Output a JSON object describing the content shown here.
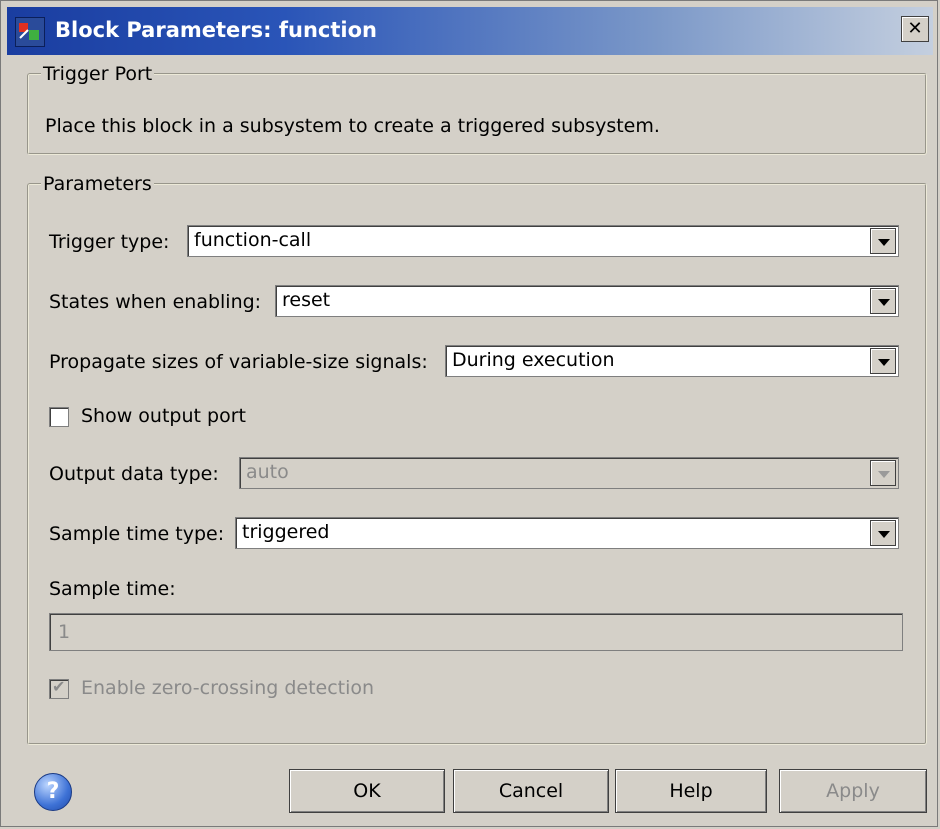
{
  "window": {
    "title": "Block Parameters: function",
    "close_label": "✕"
  },
  "trigger_port": {
    "legend": "Trigger Port",
    "description": "Place this block in a subsystem to create a triggered subsystem."
  },
  "parameters": {
    "legend": "Parameters",
    "trigger_type": {
      "label": "Trigger type:",
      "value": "function-call"
    },
    "states_when_enabling": {
      "label": "States when enabling:",
      "value": "reset"
    },
    "propagate_sizes": {
      "label": "Propagate sizes of variable-size signals:",
      "value": "During execution"
    },
    "show_output_port": {
      "label": "Show output port",
      "checked": false
    },
    "output_data_type": {
      "label": "Output data type:",
      "value": "auto"
    },
    "sample_time_type": {
      "label": "Sample time type:",
      "value": "triggered"
    },
    "sample_time": {
      "label": "Sample time:",
      "value": "1"
    },
    "zero_crossing": {
      "label": "Enable zero-crossing detection",
      "checked": true
    }
  },
  "buttons": {
    "help_icon": "?",
    "ok": "OK",
    "cancel": "Cancel",
    "help": "Help",
    "apply": "Apply"
  }
}
